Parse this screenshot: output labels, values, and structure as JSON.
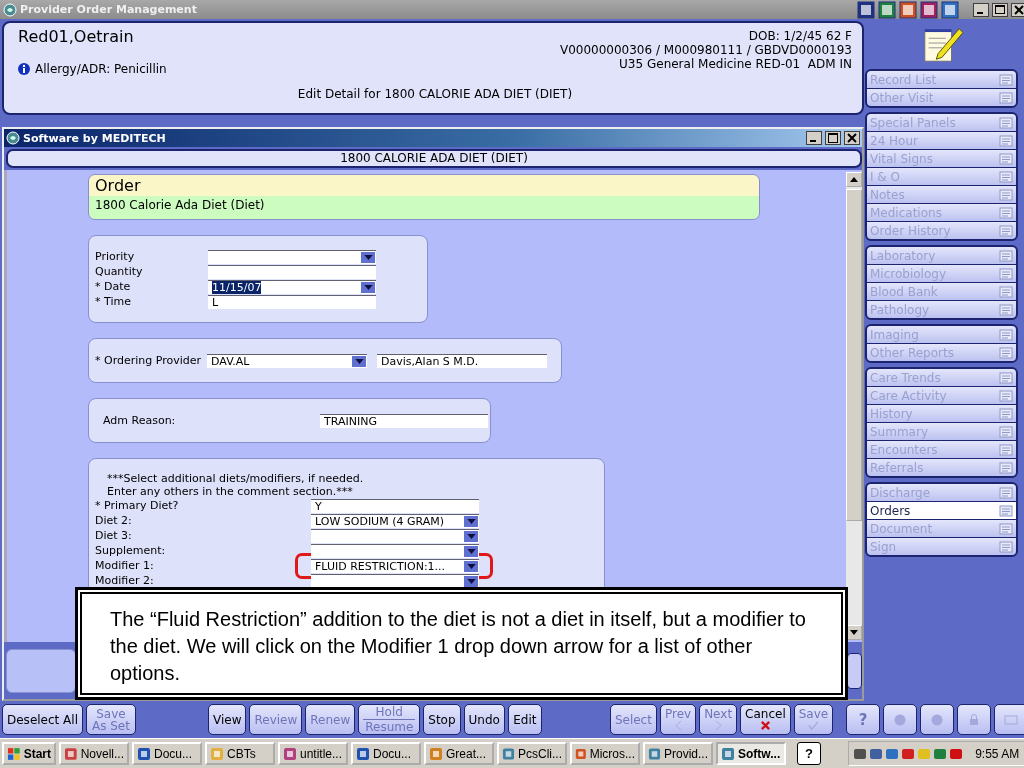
{
  "title_bar": {
    "title": "Provider Order Management"
  },
  "patient": {
    "name": "Red01,Oetrain",
    "dob": "DOB: 1/2/45 62 F",
    "account": "V00000000306 / M000980111 / GBDVD0000193",
    "location": "U35 General Medicine RED-01  ADM IN",
    "allergy": "Allergy/ADR: Penicillin",
    "edit_detail": "Edit Detail for 1800 CALORIE ADA DIET (DIET)"
  },
  "sidebar": {
    "groups": [
      {
        "items": [
          {
            "label": "Record List",
            "selected": false
          },
          {
            "label": "Other Visit",
            "selected": false
          }
        ]
      },
      {
        "items": [
          {
            "label": "Special Panels",
            "selected": false
          },
          {
            "label": "24 Hour",
            "selected": false
          },
          {
            "label": "Vital Signs",
            "selected": false
          },
          {
            "label": "I & O",
            "selected": false
          },
          {
            "label": "Notes",
            "selected": false
          },
          {
            "label": "Medications",
            "selected": false
          },
          {
            "label": "Order History",
            "selected": false
          }
        ]
      },
      {
        "items": [
          {
            "label": "Laboratory",
            "selected": false
          },
          {
            "label": "Microbiology",
            "selected": false
          },
          {
            "label": "Blood Bank",
            "selected": false
          },
          {
            "label": "Pathology",
            "selected": false
          }
        ]
      },
      {
        "items": [
          {
            "label": "Imaging",
            "selected": false
          },
          {
            "label": "Other Reports",
            "selected": false
          }
        ]
      },
      {
        "items": [
          {
            "label": "Care Trends",
            "selected": false
          },
          {
            "label": "Care Activity",
            "selected": false
          },
          {
            "label": "History",
            "selected": false
          },
          {
            "label": "Summary",
            "selected": false
          },
          {
            "label": "Encounters",
            "selected": false
          },
          {
            "label": "Referrals",
            "selected": false
          }
        ]
      },
      {
        "items": [
          {
            "label": "Discharge",
            "selected": false
          },
          {
            "label": "Orders",
            "selected": true
          },
          {
            "label": "Document",
            "selected": false
          },
          {
            "label": "Sign",
            "selected": false
          }
        ]
      }
    ]
  },
  "window": {
    "title": "Software by MEDITECH",
    "subtitle": "1800 CALORIE ADA DIET (DIET)"
  },
  "order": {
    "heading": "Order",
    "name": "1800 Calorie Ada Diet (Diet)"
  },
  "sections": [
    {
      "kind": "stacked",
      "fields": [
        {
          "label": "Priority",
          "kind": "dropdown",
          "highlighted": false
        },
        {
          "label": "Quantity",
          "kind": "text",
          "highlighted": false
        },
        {
          "label": "* Date",
          "kind": "dropdown",
          "value": "11/15/07",
          "value_selected": true,
          "highlighted": false
        },
        {
          "label": "* Time",
          "kind": "text",
          "value": "L",
          "highlighted": false
        }
      ]
    },
    {
      "kind": "inline",
      "fields": [
        {
          "label": "* Ordering Provider",
          "kind": "dropdown",
          "value": "DAV.AL",
          "highlighted": false
        },
        {
          "kind": "text",
          "value": "Davis,Alan S M.D.",
          "highlighted": false
        }
      ]
    },
    {
      "kind": "wide",
      "fields": [
        {
          "label": "Adm Reason:",
          "kind": "text",
          "value": "TRAINING",
          "highlighted": false
        }
      ]
    },
    {
      "kind": "notes",
      "note": [
        "***Select additional diets/modifiers, if needed.",
        "Enter any others in the comment section.***"
      ],
      "fields": [
        {
          "label": "* Primary Diet?",
          "kind": "text",
          "value": "Y",
          "highlighted": false
        },
        {
          "label": "Diet 2:",
          "kind": "dropdown",
          "value": "LOW SODIUM (4 GRAM)",
          "highlighted": false
        },
        {
          "label": "Diet 3:",
          "kind": "dropdown",
          "highlighted": false
        },
        {
          "label": "Supplement:",
          "kind": "dropdown",
          "highlighted": false
        },
        {
          "label": "Modifier 1:",
          "kind": "dropdown",
          "value": "FLUID RESTRICTION:1...",
          "highlighted": true
        },
        {
          "label": "Modifier 2:",
          "kind": "dropdown",
          "highlighted": false
        }
      ]
    }
  ],
  "callout": {
    "text": "The “Fluid Restriction” addition to the diet is not a diet in itself, but a modifier to the diet.  We will click on the Modifier 1 drop down arrow for a list of other options."
  },
  "toolbar": {
    "groups": [
      [
        {
          "kind": "plain",
          "label": "Deselect All",
          "disabled": false
        },
        {
          "kind": "two_line",
          "labels": [
            "Save",
            "As Set"
          ],
          "disabled": true
        }
      ],
      [
        {
          "kind": "plain",
          "label": "View",
          "disabled": false
        },
        {
          "kind": "plain",
          "label": "Review",
          "disabled": true
        },
        {
          "kind": "plain",
          "label": "Renew",
          "disabled": true
        },
        {
          "kind": "split",
          "labels": [
            "Hold",
            "Resume"
          ],
          "disabled": true
        },
        {
          "kind": "plain",
          "label": "Stop",
          "disabled": false
        },
        {
          "kind": "plain",
          "label": "Undo",
          "disabled": false
        },
        {
          "kind": "plain",
          "label": "Edit",
          "disabled": false
        }
      ],
      [
        {
          "kind": "plain",
          "label": "Select",
          "disabled": true
        },
        {
          "kind": "prev",
          "label": "Prev",
          "disabled": true
        },
        {
          "kind": "next",
          "label": "Next",
          "disabled": true
        },
        {
          "kind": "cancel",
          "label": "Cancel",
          "disabled": false
        },
        {
          "kind": "save",
          "label": "Save",
          "disabled": true
        }
      ]
    ],
    "help": "?"
  },
  "taskbar": {
    "start": "Start",
    "tasks": [
      {
        "label": "Novell...",
        "selected": false
      },
      {
        "label": "Docu...",
        "selected": false
      },
      {
        "label": "CBTs",
        "selected": false
      },
      {
        "label": "untitle...",
        "selected": false
      },
      {
        "label": "Docu...",
        "selected": false
      },
      {
        "label": "Great...",
        "selected": false
      },
      {
        "label": "PcsCli...",
        "selected": false
      },
      {
        "label": "Micros...",
        "selected": false
      },
      {
        "label": "Provid...",
        "selected": false
      },
      {
        "label": "Softw...",
        "selected": true
      }
    ],
    "help": "?",
    "clock": "9:55 AM"
  }
}
